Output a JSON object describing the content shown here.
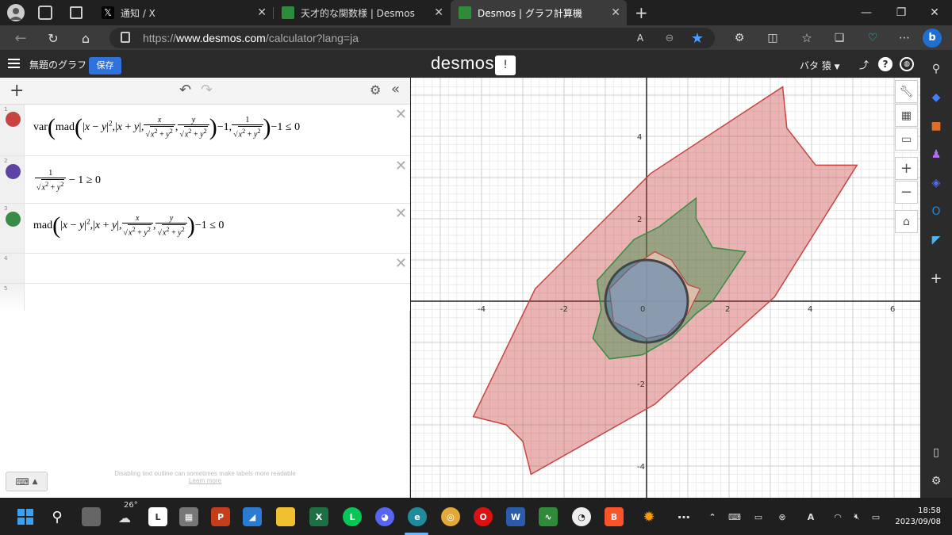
{
  "browser": {
    "tabs": [
      {
        "title": "通知 / X"
      },
      {
        "title": "天才的な関数様 | Desmos"
      },
      {
        "title": "Desmos | グラフ計算機"
      }
    ],
    "url_prefix": "https://",
    "url_host": "www.desmos.com",
    "url_path": "/calculator?lang=ja"
  },
  "desmos": {
    "graph_title": "無題のグラフ",
    "save_label": "保存",
    "logo": "desmos",
    "bang": "!",
    "user": "バタ 猿",
    "expressions": [
      {
        "index": "1",
        "color": "#c74440"
      },
      {
        "index": "2",
        "color": "#6042a6"
      },
      {
        "index": "3",
        "color": "#388c46"
      },
      {
        "index": "4"
      },
      {
        "index": "5"
      }
    ],
    "expr1": {
      "var": "var",
      "mad": "mad",
      "tail": "−1,",
      "end": "−1 ≤ 0"
    },
    "expr2": {
      "end": "− 1 ≥ 0"
    },
    "expr3": {
      "mad": "mad",
      "end": "−1 ≤ 0"
    },
    "footnote_line1": "Disabling text outline can sometimes make labels more readable",
    "footnote_line2": "Learn more"
  },
  "graph": {
    "x_ticks": [
      "-4",
      "-2",
      "0",
      "2",
      "4",
      "6"
    ],
    "y_ticks": [
      "4",
      "2",
      "-2",
      "-4"
    ],
    "region_colors": {
      "red": "#c74440",
      "green": "#388c46",
      "blue": "#2d70b3"
    }
  },
  "taskbar": {
    "weather": "26°",
    "time": "18:58",
    "date": "2023/09/08"
  }
}
